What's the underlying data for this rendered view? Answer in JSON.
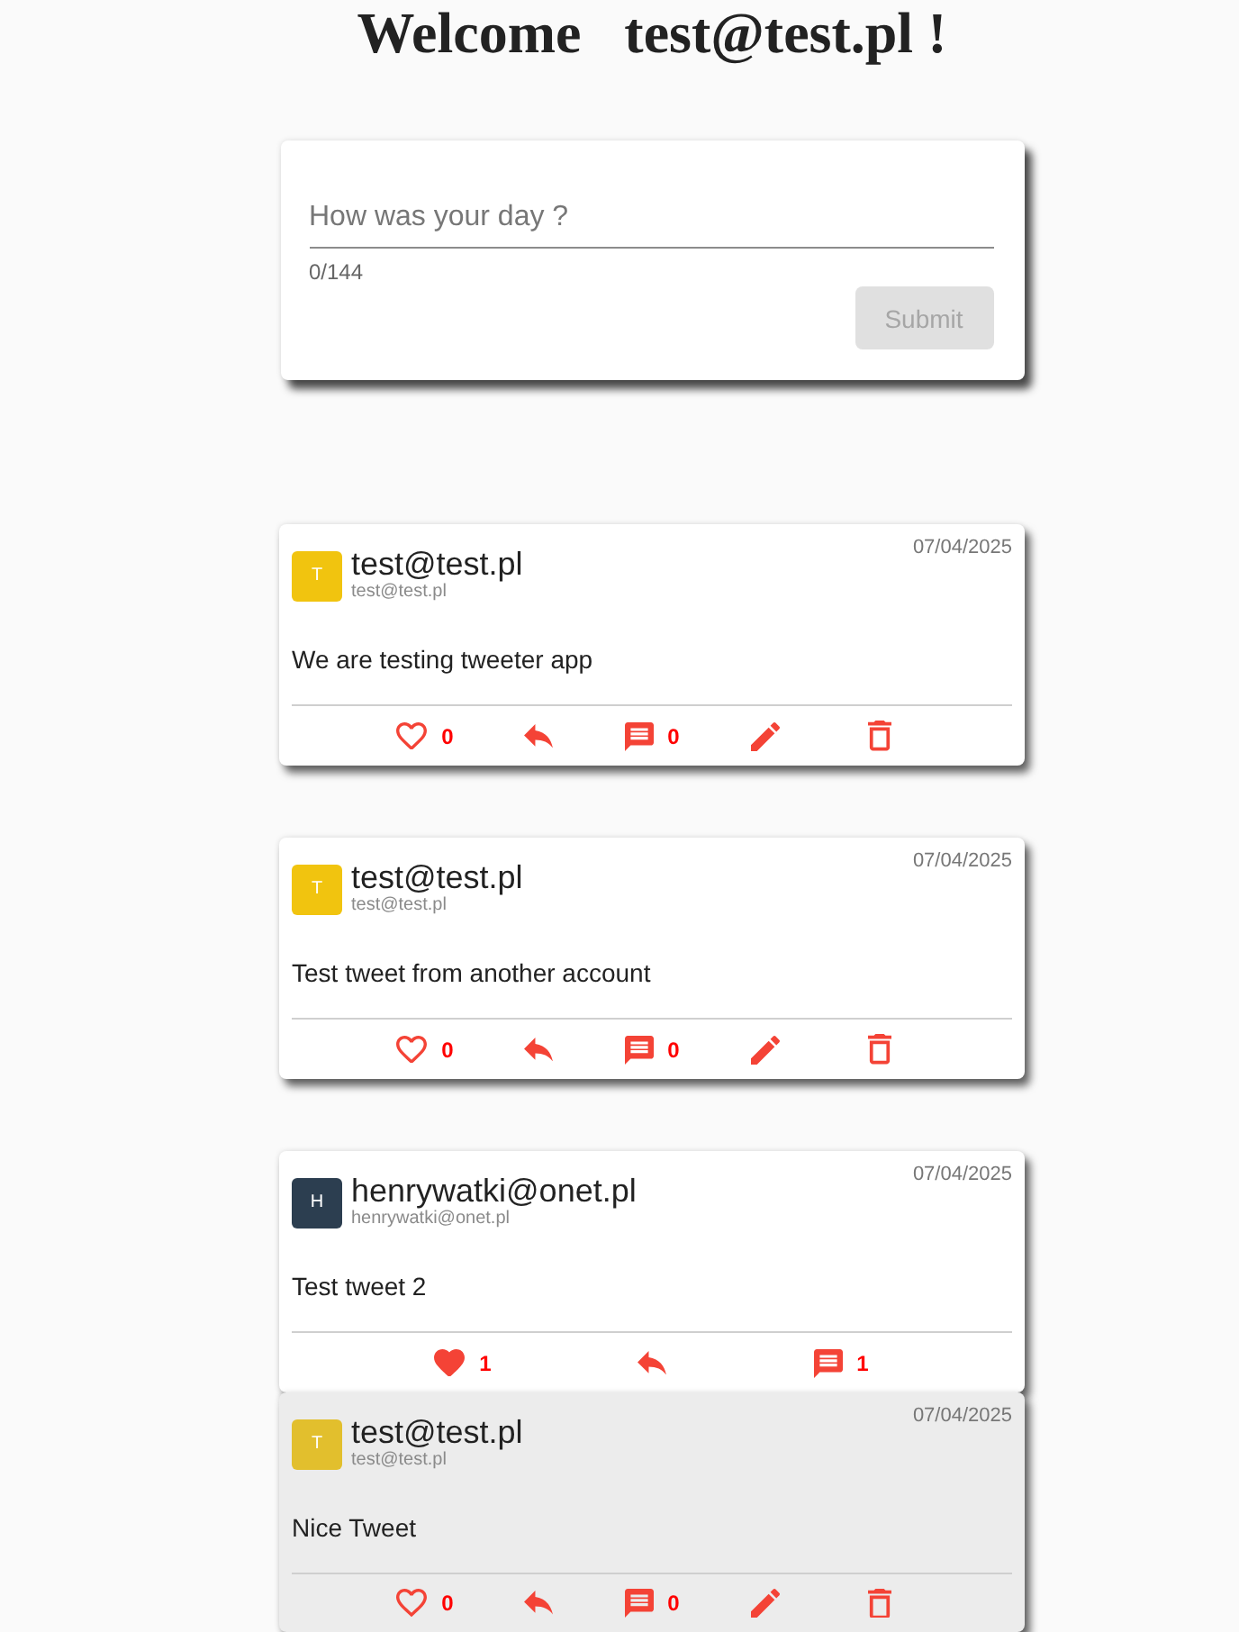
{
  "header": {
    "title": "Welcome   test@test.pl !"
  },
  "composer": {
    "placeholder": "How was your day ?",
    "counter": "0/144",
    "submit": {
      "label": "Submit",
      "disabled": true
    }
  },
  "tweets": [
    {
      "avatar": {
        "letter": "T",
        "color": "#f1c40f"
      },
      "name": "test@test.pl",
      "handle": "test@test.pl",
      "date": "07/04/2025",
      "text": "We are testing tweeter app",
      "like": {
        "count": "0",
        "liked": false
      },
      "comments": "0",
      "can_edit": true,
      "can_delete": true
    },
    {
      "avatar": {
        "letter": "T",
        "color": "#f1c40f"
      },
      "name": "test@test.pl",
      "handle": "test@test.pl",
      "date": "07/04/2025",
      "text": "Test tweet from another account",
      "like": {
        "count": "0",
        "liked": false
      },
      "comments": "0",
      "can_edit": true,
      "can_delete": true
    },
    {
      "avatar": {
        "letter": "H",
        "color": "#2c3e50"
      },
      "name": "henrywatki@onet.pl",
      "handle": "henrywatki@onet.pl",
      "date": "07/04/2025",
      "text": "Test tweet 2",
      "like": {
        "count": "1",
        "liked": true
      },
      "comments": "1",
      "can_edit": false,
      "can_delete": false,
      "replies": [
        {
          "avatar": {
            "letter": "T",
            "color": "#e2bf2d"
          },
          "name": "test@test.pl",
          "handle": "test@test.pl",
          "date": "07/04/2025",
          "text": "Nice Tweet",
          "like": {
            "count": "0",
            "liked": false
          },
          "comments": "0",
          "can_edit": true,
          "can_delete": true
        }
      ]
    }
  ]
}
